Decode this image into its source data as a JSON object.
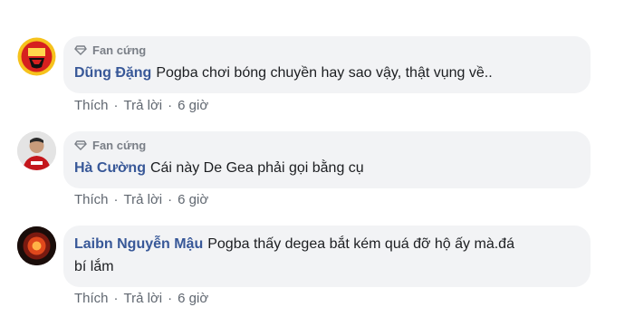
{
  "comments": [
    {
      "badge": "Fan cứng",
      "author": "Dũng Đặng",
      "text": "Pogba chơi bóng chuyền hay sao vậy, thật vụng về..",
      "actions": {
        "like": "Thích",
        "reply": "Trả lời",
        "time": "6 giờ"
      },
      "avatar_icon": "manchester-united-crest-icon"
    },
    {
      "badge": "Fan cứng",
      "author": "Hà Cường",
      "text": "Cái này De Gea phải gọi bằng cụ",
      "actions": {
        "like": "Thích",
        "reply": "Trả lời",
        "time": "6 giờ"
      },
      "avatar_icon": "user-photo-icon"
    },
    {
      "author": "Laibn Nguyễn Mậu",
      "text_line1": "Pogba thấy degea bắt kém quá đỡ hộ ấy mà.đá",
      "text_line2": "bí lắm",
      "actions": {
        "like": "Thích",
        "reply": "Trả lời",
        "time": "6 giờ"
      },
      "avatar_icon": "red-devil-logo-icon"
    }
  ],
  "colors": {
    "author": "#385898",
    "bubble": "#f2f3f5",
    "meta": "#606770",
    "badge": "#7a7f87"
  },
  "separator": "·"
}
